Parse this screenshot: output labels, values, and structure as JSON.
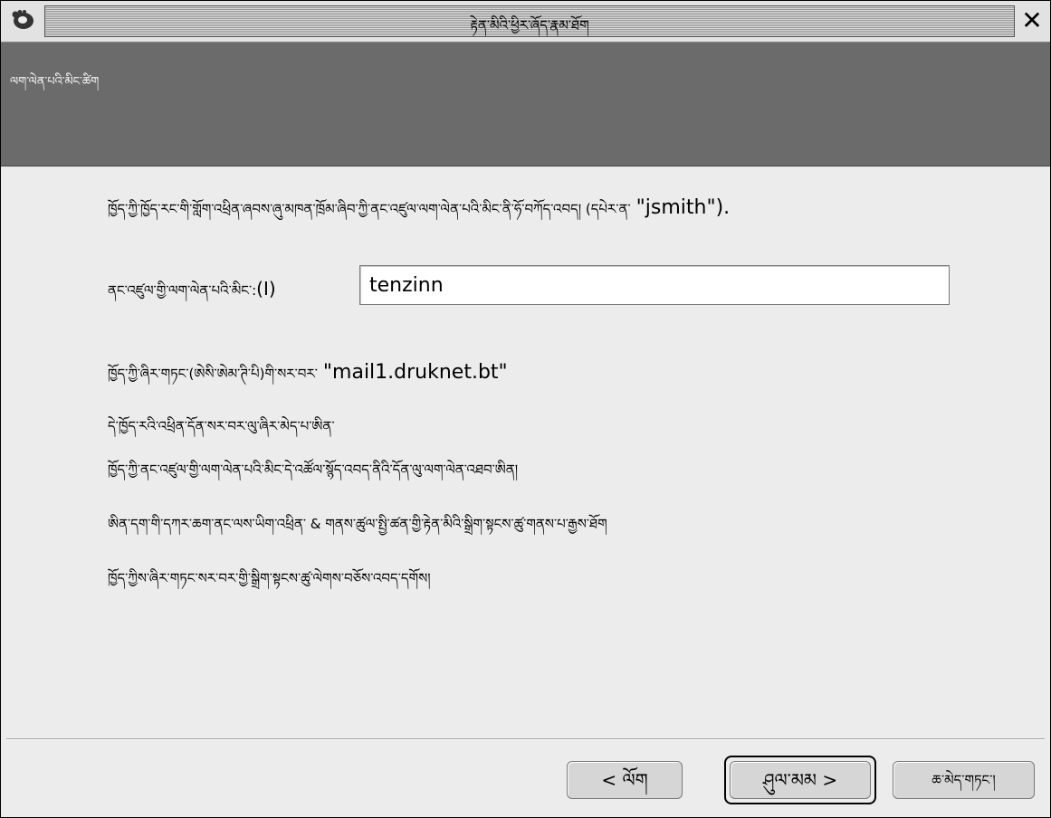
{
  "window": {
    "title": "རྟེན་མིའི་ཕྱིར་ཞོད་རྣམ་ཐོག",
    "close_symbol": "✕"
  },
  "header": {
    "page_title": "ལག་ལེན་པའི་མིང་ཚིག"
  },
  "content": {
    "line1_tibetan": "ཁྱོད་ཀྱི་ཁྱོད་རང་གི་གློག་འཕྲིན་ཞབས་ཞུ་མཁན་ཁྲོམ་ཞིབ་ཀྱི་ནང་འཛུལ་ལག་ལེན་པའི་མིང་ནི་ཧོ་བཀོད་འབད། (དཔེར་ན་",
    "line1_latin": "\"jsmith\").",
    "field_label": "ནང་འཛུལ་གྱི་ལག་ལེན་པའི་མིང་:",
    "field_mnemonic": "(I)",
    "username_value": "tenzinn",
    "line3_tibetan": "ཁྱོད་ཀྱི་ཞིར་གཏང་(ཨེསི་ཨེམ་ཊི་པི)གི་སར་བར་",
    "line3_latin": "\"mail1.druknet.bt\"",
    "line4": "དེ་ཁྱོད་རའི་འཕྲིན་དོན་སར་བར་ལུ་ཞིར་མེད་པ་ཨིན་",
    "line5": "ཁྱོད་ཀྱི་ནང་འཛུལ་གྱི་ལག་ལེན་པའི་མིང་དེ་འཚོལ་སྙོད་འབད་ནིའི་དོན་ལུ་ལག་ལེན་འཐབ་ཨིན།",
    "line6": "ཨིན་དག་གི་དཀར་ཆག་ནང་ལས་ཡིག་འཕྲིན་ & གནས་ཚུལ་སྤྱི་ཚན་གྱི་རྟེན་མིའི་སྒྲིག་སྟངས་ཚུ་གནས་པ་རྒྱས་ཐོག",
    "line7": "ཁྱོད་ཀྱིས་ཞིར་གཏང་སར་བར་གྱི་སྒྲིག་སྟངས་ཚུ་ལེགས་བཅོས་འབད་དགོས།"
  },
  "buttons": {
    "back_label": "< ལོག",
    "next_label": "ཤུལ་མམ >",
    "cancel_label": "ཆ་མེད་གཏང་།"
  }
}
